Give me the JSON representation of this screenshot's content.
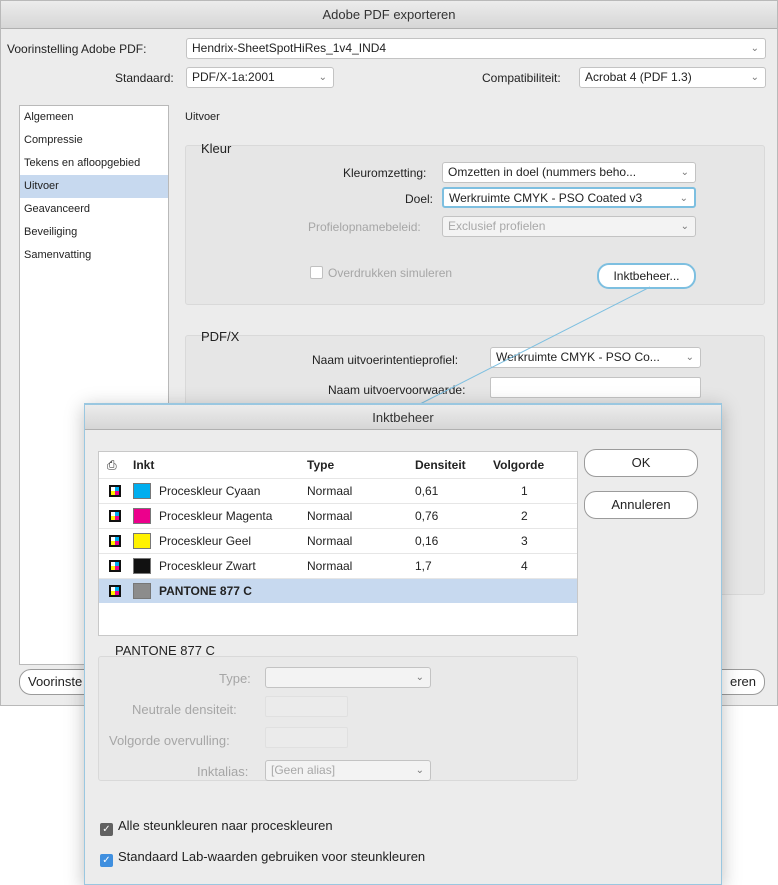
{
  "main": {
    "title": "Adobe PDF exporteren",
    "preset_label": "Voorinstelling Adobe PDF:",
    "preset_value": "Hendrix-SheetSpotHiRes_1v4_IND4",
    "standard_label": "Standaard:",
    "standard_value": "PDF/X-1a:2001",
    "compat_label": "Compatibiliteit:",
    "compat_value": "Acrobat 4 (PDF 1.3)",
    "sidebar": [
      "Algemeen",
      "Compressie",
      "Tekens en afloopgebied",
      "Uitvoer",
      "Geavanceerd",
      "Beveiliging",
      "Samenvatting"
    ],
    "section_title": "Uitvoer",
    "kleur": {
      "title": "Kleur",
      "conversion_label": "Kleuromzetting:",
      "conversion_value": "Omzetten in doel (nummers beho...",
      "target_label": "Doel:",
      "target_value": "Werkruimte CMYK - PSO Coated v3",
      "profile_label": "Profielopnamebeleid:",
      "profile_value": "Exclusief profielen",
      "overprint_label": "Overdrukken simuleren",
      "ink_button": "Inktbeheer..."
    },
    "pdfx": {
      "title": "PDF/X",
      "output_profile_label": "Naam uitvoerintentieprofiel:",
      "output_profile_value": "Werkruimte CMYK - PSO Co...",
      "output_condition_label": "Naam uitvoervoorwaarde:"
    },
    "bottom_left_button": "Voorinste",
    "bottom_right_button": "eren"
  },
  "ink": {
    "title": "Inktbeheer",
    "columns": [
      "Inkt",
      "Type",
      "Densiteit",
      "Volgorde"
    ],
    "rows": [
      {
        "name": "Proceskleur Cyaan",
        "type": "Normaal",
        "density": "0,61",
        "order": "1",
        "color": "#00aeef"
      },
      {
        "name": "Proceskleur Magenta",
        "type": "Normaal",
        "density": "0,76",
        "order": "2",
        "color": "#ec008c"
      },
      {
        "name": "Proceskleur Geel",
        "type": "Normaal",
        "density": "0,16",
        "order": "3",
        "color": "#fff200"
      },
      {
        "name": "Proceskleur Zwart",
        "type": "Normaal",
        "density": "1,7",
        "order": "4",
        "color": "#111111"
      },
      {
        "name": "PANTONE 877 C",
        "type": "",
        "density": "",
        "order": "",
        "color": "#8c8c8c"
      }
    ],
    "ok": "OK",
    "cancel": "Annuleren",
    "detail": {
      "title": "PANTONE 877 C",
      "type_label": "Type:",
      "density_label": "Neutrale densiteit:",
      "trap_label": "Volgorde overvulling:",
      "alias_label": "Inktalias:",
      "alias_value": "[Geen alias]"
    },
    "cb_all_process": "Alle steunkleuren naar proceskleuren",
    "cb_lab": "Standaard Lab-waarden gebruiken voor steunkleuren"
  },
  "colors": {
    "accent": "#7dbfe0",
    "selection": "#c7d9ef",
    "window_bg": "#ececec"
  }
}
